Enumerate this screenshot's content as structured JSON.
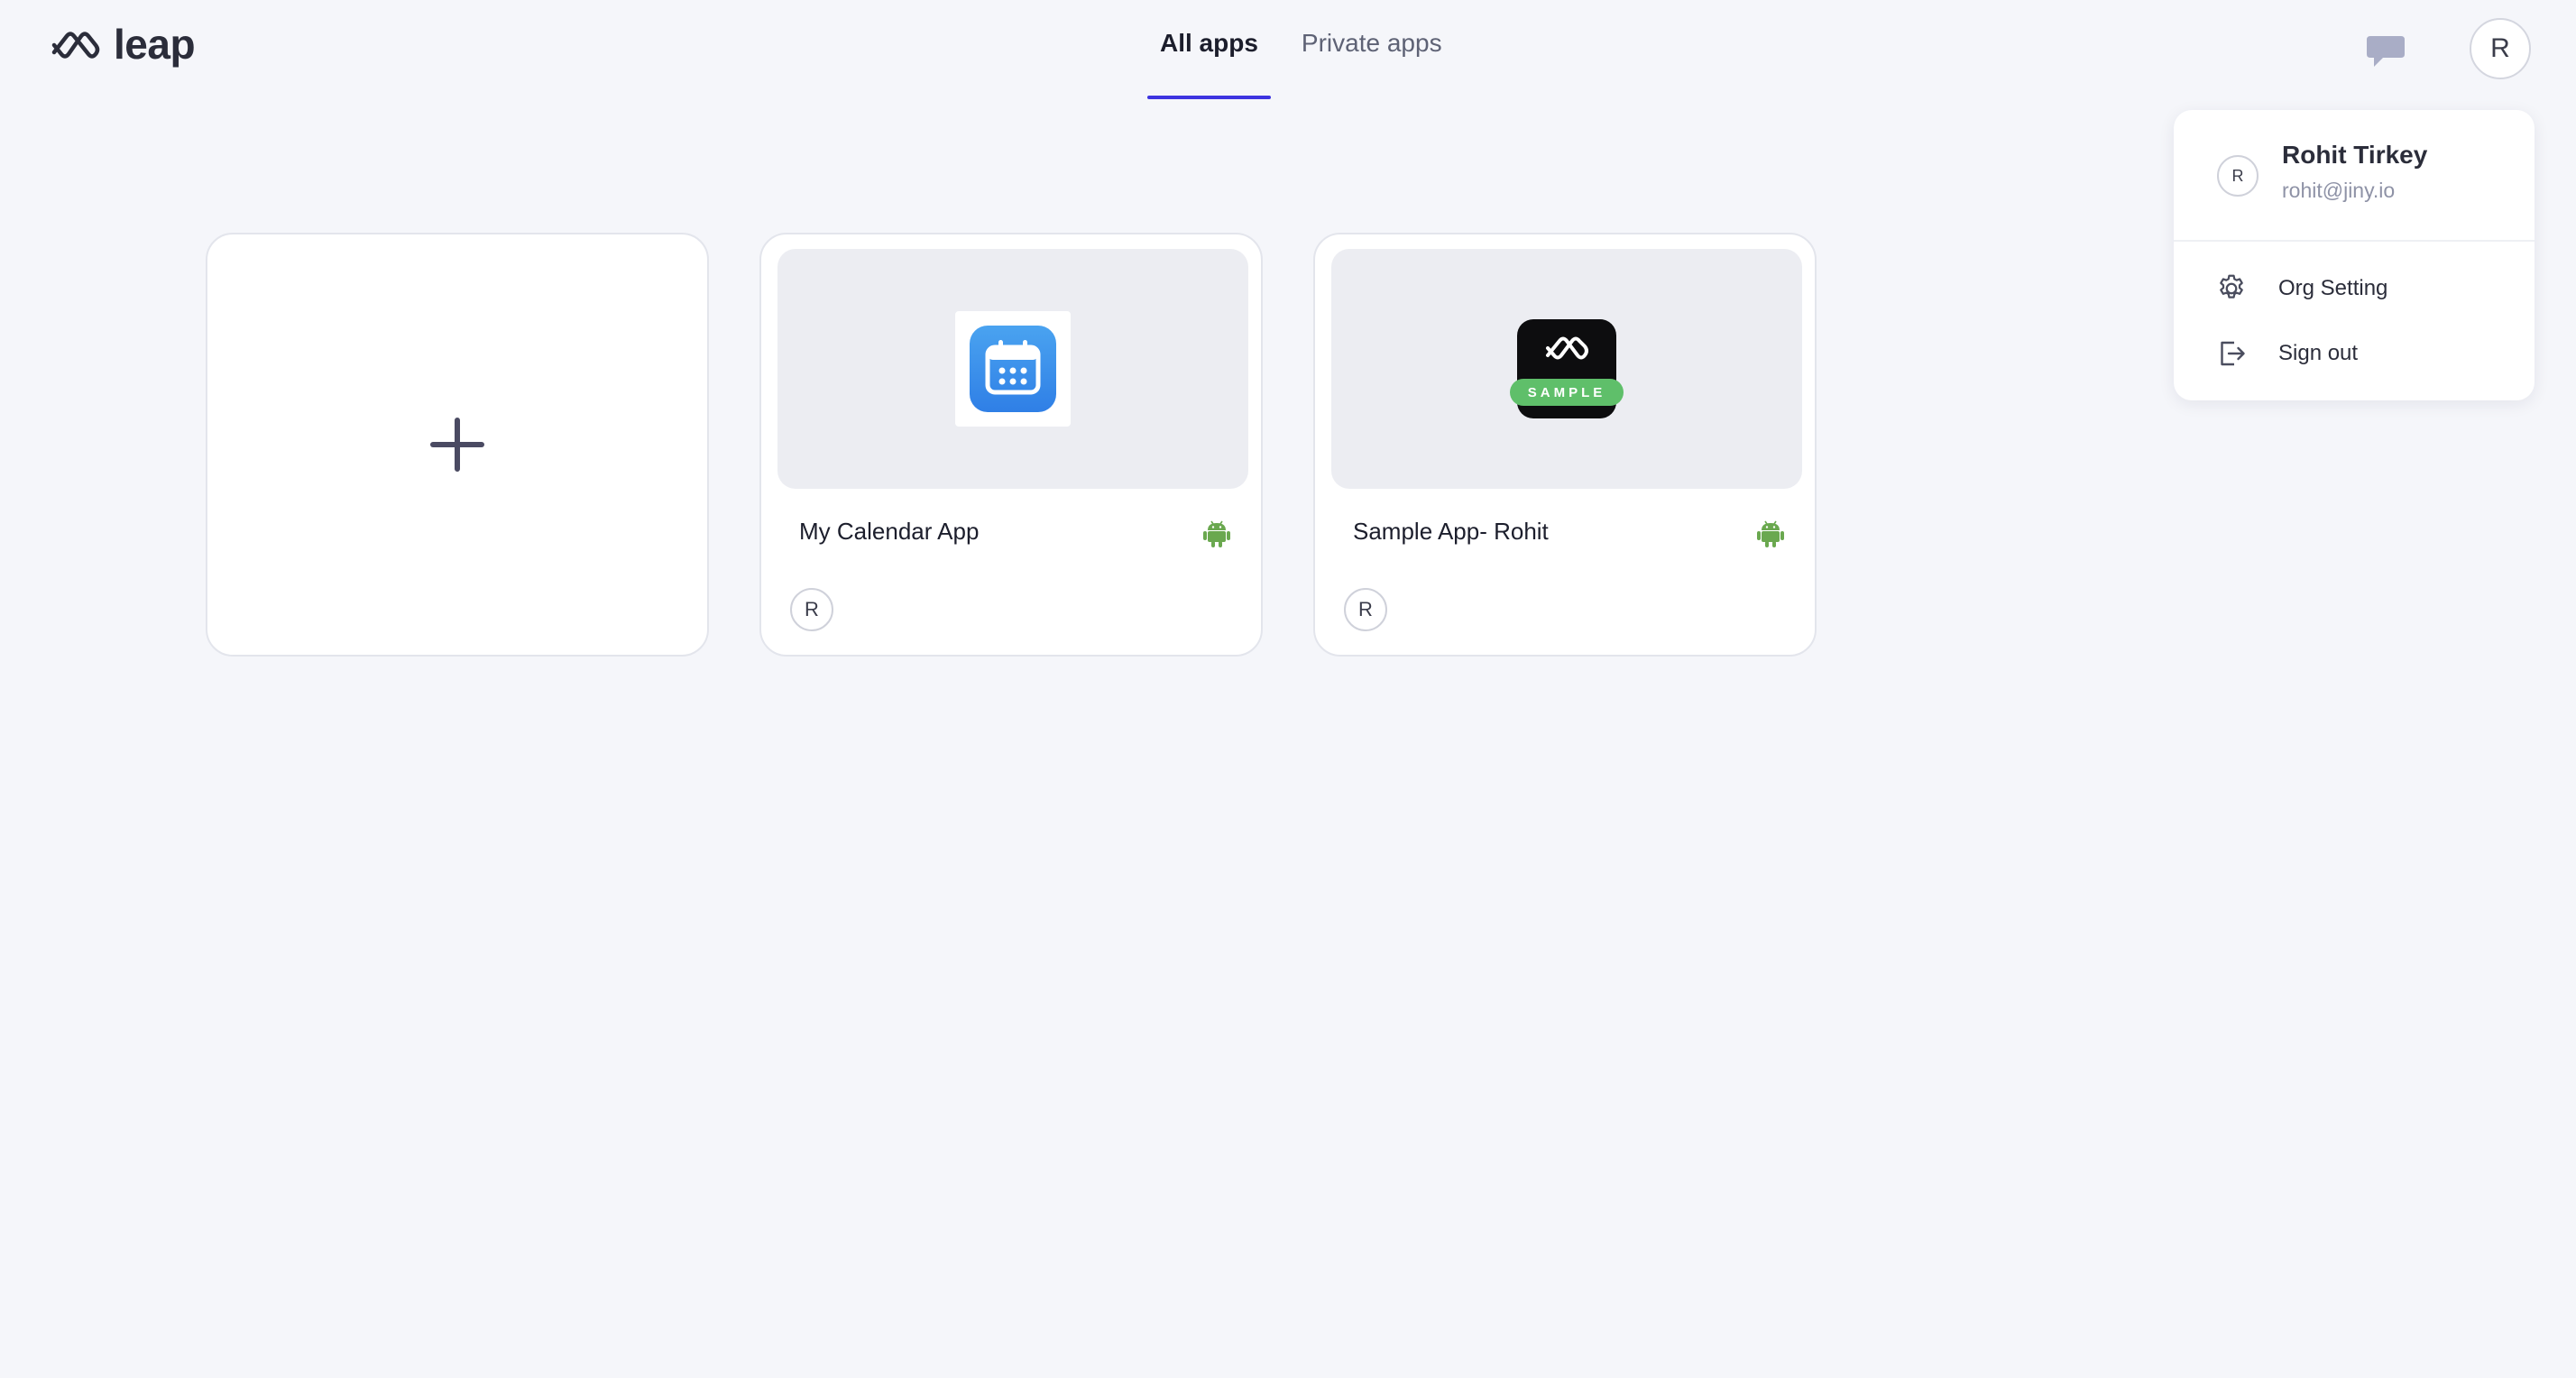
{
  "brand": {
    "name": "leap"
  },
  "nav": {
    "tabs": [
      {
        "label": "All apps",
        "active": true
      },
      {
        "label": "Private apps",
        "active": false
      }
    ]
  },
  "header": {
    "avatar_initial": "R",
    "chat_icon": "chat-bubble-icon"
  },
  "apps": [
    {
      "name": "My Calendar App",
      "platform": "android",
      "owner_initial": "R",
      "icon": "calendar-icon"
    },
    {
      "name": "Sample App- Rohit",
      "platform": "android",
      "owner_initial": "R",
      "icon": "leap-sample-icon",
      "badge": "SAMPLE"
    }
  ],
  "new_app": {
    "icon": "plus-icon"
  },
  "user_menu": {
    "initial": "R",
    "name": "Rohit Tirkey",
    "email": "rohit@jiny.io",
    "items": [
      {
        "label": "Org Setting",
        "icon": "gear-icon"
      },
      {
        "label": "Sign out",
        "icon": "sign-out-icon"
      }
    ]
  },
  "colors": {
    "accent": "#3d34e0",
    "background": "#f5f6fa",
    "android": "#6aa84f",
    "sample_badge": "#5fbf6a"
  }
}
